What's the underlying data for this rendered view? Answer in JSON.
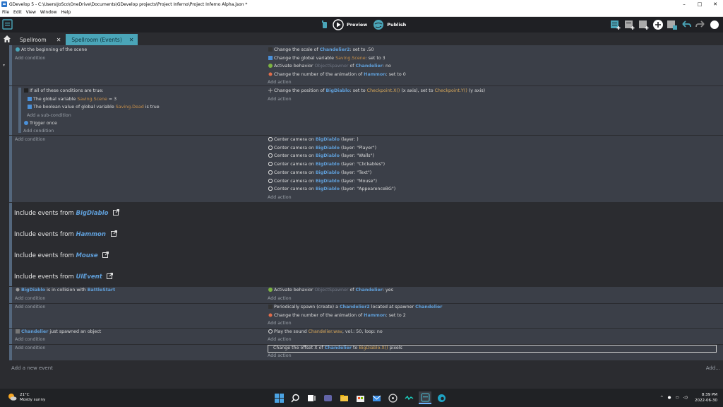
{
  "window": {
    "title": "GDevelop 5 - C:\\Users\\JoSco\\OneDrive\\Documents\\GDevelop projects\\Project Inferno\\Project Inferno Alpha.json *",
    "min": "–",
    "max": "□",
    "close": "✕"
  },
  "menu": [
    "File",
    "Edit",
    "View",
    "Window",
    "Help"
  ],
  "toolbar": {
    "preview": "Preview",
    "publish": "Publish"
  },
  "tabs": [
    {
      "label": "Spellroom",
      "close": "✕"
    },
    {
      "label": "Spellroom (Events)",
      "close": "✕"
    }
  ],
  "events": {
    "e1": {
      "condition": "At the beginning of the scene",
      "add_condition": "Add condition",
      "actions": [
        {
          "pre": "Change the scale of",
          "obj": "Chandelier2",
          "post": ": set to .50"
        },
        {
          "pre": "Change the global variable",
          "var": "Saving.Scene",
          "post": ": set to 3"
        },
        {
          "pre": "Activate behavior",
          "muted": "ObjectSpawner",
          "mid": "of",
          "obj": "Chandelier",
          "post": ": no"
        },
        {
          "pre": "Change the number of the animation of",
          "obj": "Hammon",
          "post": ": set to 0"
        }
      ],
      "add_action": "Add action"
    },
    "e2": {
      "all": "If all of these conditions are true:",
      "c1": {
        "pre": "The global variable",
        "var": "Saving.Scene",
        "post": "= 3"
      },
      "c2": {
        "pre": "The boolean value of global variable",
        "var": "Saving.Dead",
        "post": "is true"
      },
      "add_sub": "Add a sub-condition",
      "trigger": "Trigger once",
      "add_condition": "Add condition",
      "action": {
        "pre": "Change the position of",
        "obj": "BigDiablo",
        "p1": ": set to",
        "v1": "Checkpoint.X()",
        "p2": "(x axis), set to",
        "v2": "Checkpoint.Y()",
        "p3": "(y axis)"
      },
      "add_action": "Add action"
    },
    "e3": {
      "add_condition": "Add condition",
      "pre": "Center camera on",
      "obj": "BigDiablo",
      "layers": [
        "(layer: )",
        "(layer: \"Player\")",
        "(layer: \"Walls\")",
        "(layer: \"Clickables\")",
        "(layer: \"Text\")",
        "(layer: \"Mouse\")",
        "(layer: \"AppearenceBG\")"
      ],
      "add_action": "Add action"
    },
    "includes": [
      {
        "pre": "Include events from",
        "name": "BigDiablo"
      },
      {
        "pre": "Include events from",
        "name": "Hammon"
      },
      {
        "pre": "Include events from",
        "name": "Mouse"
      },
      {
        "pre": "Include events from",
        "name": "UIEvent"
      }
    ],
    "e4": {
      "obj": "BigDiablo",
      "mid": "is in collision with",
      "obj2": "BattleStart",
      "add_condition": "Add condition",
      "action": {
        "pre": "Activate behavior",
        "muted": "ObjectSpawner",
        "mid": "of",
        "obj": "Chandelier",
        "post": ": yes"
      },
      "add_action": "Add action"
    },
    "e5": {
      "add_condition": "Add condition",
      "a1": {
        "pre": "Periodically spawn (create) a",
        "obj": "Chandelier2",
        "mid": "located at spawner",
        "obj2": "Chandelier"
      },
      "a2": {
        "pre": "Change the number of the animation of",
        "obj": "Hammon",
        "post": ": set to 2"
      },
      "add_action": "Add action"
    },
    "e6": {
      "obj": "Chandelier",
      "post": "just spawned an object",
      "add_condition": "Add condition",
      "action": {
        "pre": "Play the sound",
        "val": "Chandelier.wav",
        "post": ", vol.: 50, loop: no"
      },
      "add_action": "Add action"
    },
    "e7": {
      "add_condition": "Add condition",
      "action": {
        "pre": "Change the offset X of",
        "obj": "Chandelier",
        "mid": "to",
        "val": "BigDiablo.X()",
        "post": "pixels"
      },
      "add_action": "Add action"
    }
  },
  "add_new_event": "Add a new event",
  "add_more": "Add...",
  "taskbar": {
    "temp": "21°C",
    "weather": "Mostly sunny",
    "time": "8:39 PM",
    "date": "2022-06-30"
  },
  "colors": {
    "accent": "#4aa5b8",
    "object": "#5f9ed8",
    "value": "#d8a85a"
  }
}
